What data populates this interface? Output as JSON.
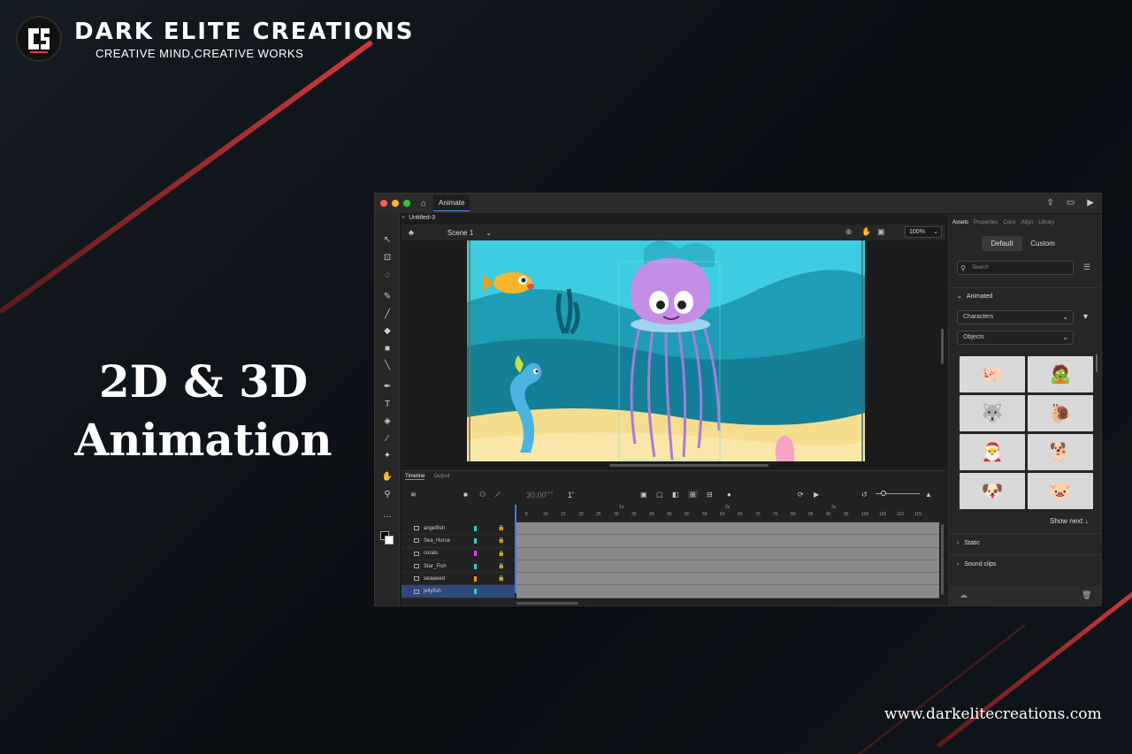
{
  "brand": {
    "name": "DARK ELITE CREATIONS",
    "tagline": "CREATIVE MIND,CREATIVE WORKS",
    "accent": "#e63946"
  },
  "headline": {
    "line1": "2D & 3D",
    "line2": "Animation"
  },
  "website": "www.darkelitecreations.com",
  "app": {
    "tab": "Animate",
    "document_tab": "Untitled-3",
    "scene": "Scene 1",
    "zoom": "100%",
    "panel": {
      "tabs": [
        "Assets",
        "Properties",
        "Color",
        "Align",
        "Library"
      ],
      "segments": [
        "Default",
        "Custom"
      ],
      "search_placeholder": "Search",
      "section_animated": "Animated",
      "dropdown_characters": "Characters",
      "dropdown_objects": "Objects",
      "show_next": "Show next ↓",
      "section_static": "Static",
      "section_sound": "Sound clips"
    },
    "timeline": {
      "tabs": [
        "Timeline",
        "Output"
      ],
      "fps": "30.00",
      "fps_unit": "FPS",
      "frame": "1",
      "frame_unit": "F",
      "ruler_ticks": [
        "5",
        "10",
        "15",
        "20",
        "25",
        "30",
        "35",
        "40",
        "45",
        "50",
        "55",
        "60",
        "65",
        "70",
        "75",
        "80",
        "85",
        "90",
        "95",
        "100",
        "105",
        "110",
        "115"
      ],
      "ruler_seconds": [
        "1s",
        "2s",
        "3s"
      ],
      "layers": [
        {
          "name": "angelfish",
          "color": "#2fd1c9"
        },
        {
          "name": "Sea_Horse",
          "color": "#2fd1c9"
        },
        {
          "name": "corals",
          "color": "#e040fb"
        },
        {
          "name": "Star_Fish",
          "color": "#2fd1c9"
        },
        {
          "name": "seaweed",
          "color": "#ff9800"
        },
        {
          "name": "jellyfish",
          "color": "#2fd1c9",
          "selected": true
        }
      ]
    }
  }
}
